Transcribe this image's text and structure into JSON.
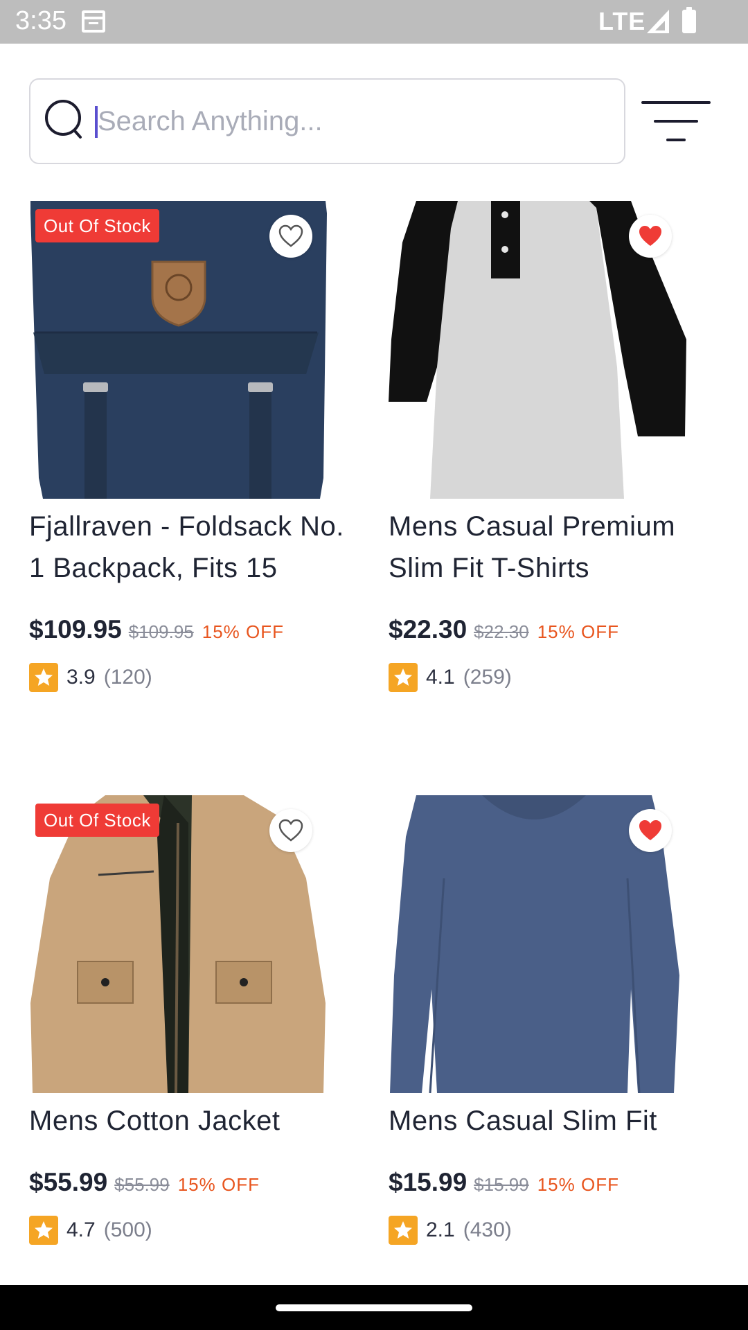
{
  "status_bar": {
    "time": "3:35",
    "network": "LTE",
    "icons": [
      "calendar-icon",
      "signal-icon",
      "battery-icon"
    ]
  },
  "search": {
    "placeholder": "Search Anything...",
    "value": ""
  },
  "colors": {
    "badge": "#ef3b36",
    "favorite": "#ef3b36",
    "discount": "#e8551e",
    "star": "#f5a524"
  },
  "products": [
    {
      "title": "Fjallraven - Foldsack No. 1 Backpack, Fits 15",
      "price": "$109.95",
      "old_price": "$109.95",
      "discount": "15% OFF",
      "rating": "3.9",
      "reviews": "(120)",
      "badge": "Out Of Stock",
      "favorited": false,
      "image": "navy backpack"
    },
    {
      "title": "Mens Casual Premium Slim Fit T-Shirts",
      "price": "$22.30",
      "old_price": "$22.30",
      "discount": "15% OFF",
      "rating": "4.1",
      "reviews": "(259)",
      "badge": "",
      "favorited": true,
      "image": "raglan t-shirt"
    },
    {
      "title": "Mens Cotton Jacket",
      "price": "$55.99",
      "old_price": "$55.99",
      "discount": "15% OFF",
      "rating": "4.7",
      "reviews": "(500)",
      "badge": "Out Of Stock",
      "favorited": false,
      "image": "khaki jacket"
    },
    {
      "title": "Mens Casual Slim Fit",
      "price": "$15.99",
      "old_price": "$15.99",
      "discount": "15% OFF",
      "rating": "2.1",
      "reviews": "(430)",
      "badge": "",
      "favorited": true,
      "image": "blue long sleeve shirt"
    }
  ]
}
